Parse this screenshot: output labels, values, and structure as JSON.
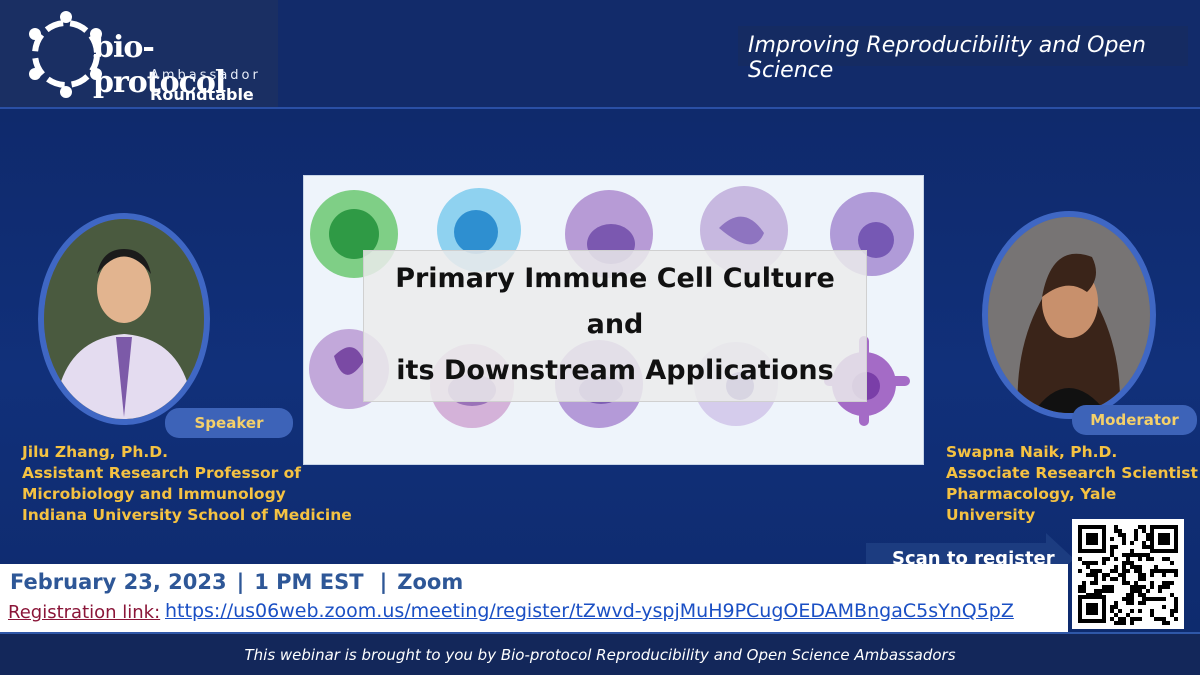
{
  "header": {
    "logo_title": "bio-protocol",
    "logo_sub": "Ambassador",
    "logo_round": "Roundtable",
    "tagline": "Improving Reproducibility and Open Science"
  },
  "main": {
    "title_lines": [
      "Primary Immune Cell Culture",
      "and",
      "its Downstream Applications"
    ]
  },
  "speaker": {
    "badge": "Speaker",
    "lines": [
      "Jilu Zhang, Ph.D.",
      "Assistant Research Professor of",
      "Microbiology and Immunology",
      "Indiana University School of Medicine"
    ]
  },
  "moderator": {
    "badge": "Moderator",
    "lines": [
      "Swapna Naik, Ph.D.",
      "Associate Research Scientist",
      "Pharmacology, Yale University"
    ]
  },
  "event": {
    "date": "February 23, 2023",
    "time": "1 PM EST",
    "platform": "Zoom",
    "separator": "|",
    "reg_label": "Registration link:",
    "reg_url": "https://us06web.zoom.us/meeting/register/tZwvd-yspjMuH9PCugOEDAMBngaC5sYnQ5pZ"
  },
  "scan": {
    "text": "Scan to register"
  },
  "footer": {
    "text": "This webinar is brought to you by Bio-protocol Reproducibility and Open Science Ambassadors"
  },
  "colors": {
    "background": "#11307a",
    "accent_gold": "#f5c242",
    "badge_blue": "#3d63b8",
    "date_blue": "#2e5797"
  }
}
